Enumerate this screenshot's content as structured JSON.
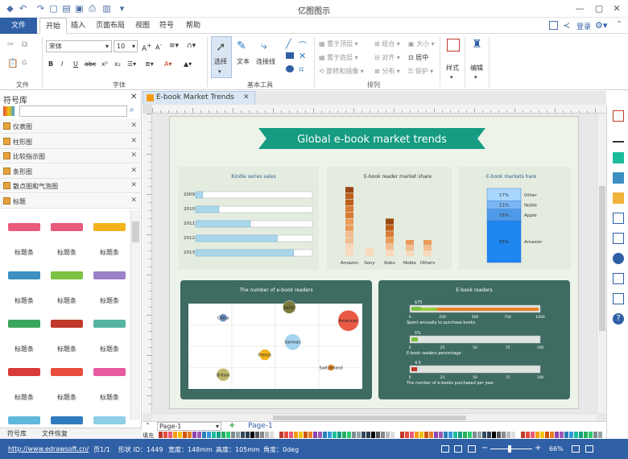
{
  "app": {
    "title": "亿图图示"
  },
  "menubar": {
    "file": "文件",
    "tabs": [
      "开始",
      "插入",
      "页面布局",
      "视图",
      "符号",
      "帮助"
    ],
    "login": "登录"
  },
  "ribbon": {
    "font_name": "宋体",
    "font_size": "10",
    "groups": {
      "file": "文件",
      "font": "字体",
      "basic_tools": "基本工具",
      "arrange": "排列"
    },
    "tools": {
      "select": "选择",
      "text": "文本",
      "connector": "连接线",
      "style": "样式",
      "edit": "编辑"
    },
    "arrange": {
      "bring_front": "置于顶层",
      "send_back": "置于底层",
      "rotate": "旋转和镜像",
      "group": "组合",
      "align": "对齐",
      "distribute": "分布",
      "size": "大小",
      "center": "居中",
      "protect": "保护"
    }
  },
  "left_panel": {
    "title": "符号库",
    "categories": [
      "仪表图",
      "柱形图",
      "比较指示图",
      "条形图",
      "散点图和气泡图",
      "标题"
    ],
    "banner_label": "标题条",
    "bottom_tabs": [
      "符号库",
      "文件恢复"
    ]
  },
  "document": {
    "tab_title": "E-book Market Trends",
    "main_title": "Global e-book market trends",
    "panels": {
      "kindle": "Kindle series sales",
      "reader_share": "E-book reader market share",
      "ebook_share": "E-book markets hare",
      "readers_count": "The number of e-book readers",
      "readers": "E-book readers"
    },
    "gauge_labels": [
      "Spent annually to purchase books",
      "E-book readers percentage",
      "The number of e-books purchased per year"
    ]
  },
  "chart_data": [
    {
      "type": "bar",
      "title": "Kindle series sales",
      "categories": [
        "2009",
        "2010",
        "2011",
        "2012",
        "2013"
      ],
      "values": [
        6,
        20,
        47,
        70,
        84
      ],
      "ylim": [
        0,
        100
      ]
    },
    {
      "type": "bar",
      "title": "E-book reader market share",
      "categories": [
        "Amazon",
        "Sony",
        "Kobo",
        "Noble",
        "Others"
      ],
      "values": [
        62,
        8,
        34,
        15,
        15
      ]
    },
    {
      "type": "bar",
      "title": "E-book markets hare",
      "categories": [
        "Other",
        "Noble",
        "Apple",
        "Amazon"
      ],
      "values": [
        17,
        11,
        16,
        56
      ],
      "labels": [
        "17%",
        "11%",
        "16%",
        "56%"
      ]
    },
    {
      "type": "scatter",
      "title": "The number of e-book readers",
      "points": [
        {
          "name": "China",
          "x": 1.0,
          "y": 2.0,
          "r": 5,
          "color": "#6d8fbf"
        },
        {
          "name": "Japan",
          "x": 2.9,
          "y": 2.75,
          "r": 8,
          "color": "#7a7a3a"
        },
        {
          "name": "American",
          "x": 4.6,
          "y": 1.8,
          "r": 13,
          "color": "#e85a43"
        },
        {
          "name": "German",
          "x": 3.0,
          "y": 0.3,
          "r": 10,
          "color": "#a5d3ef"
        },
        {
          "name": "French",
          "x": 2.2,
          "y": -0.6,
          "r": 7,
          "color": "#f2b21b"
        },
        {
          "name": "Switzerland",
          "x": 4.1,
          "y": -1.5,
          "r": 4,
          "color": "#e8842a"
        },
        {
          "name": "Britain",
          "x": 1.0,
          "y": -2.0,
          "r": 8,
          "color": "#c0b86b"
        }
      ],
      "xlim": [
        0,
        5
      ],
      "ylim": [
        -3,
        3
      ]
    },
    {
      "type": "bar",
      "title": "E-book readers",
      "gauges": [
        {
          "label": "Spent annually to purchase books",
          "value": 75,
          "max": 1000,
          "ticks": [
            "0",
            "250",
            "500",
            "750",
            "1000"
          ],
          "readout": "$75"
        },
        {
          "label": "E-book readers percentage",
          "value": 5,
          "max": 100,
          "ticks": [
            "0",
            "25",
            "50",
            "75",
            "100"
          ],
          "readout": "5%"
        },
        {
          "label": "The number of e-books purchased per year",
          "value": 4.5,
          "max": 100,
          "ticks": [
            "0",
            "25",
            "50",
            "75",
            "100"
          ],
          "readout": "4.5"
        }
      ]
    }
  ],
  "pagebar": {
    "page_select": "Page-1",
    "active_page": "Page-1",
    "fill_label": "填充"
  },
  "status": {
    "url": "http://www.edrawsoft.cn/",
    "page": "页1/1",
    "shape_id": "形状 ID：1449",
    "width": "宽度：148mm",
    "height": "高度：105mm",
    "angle": "角度：0deg",
    "zoom": "66%"
  }
}
